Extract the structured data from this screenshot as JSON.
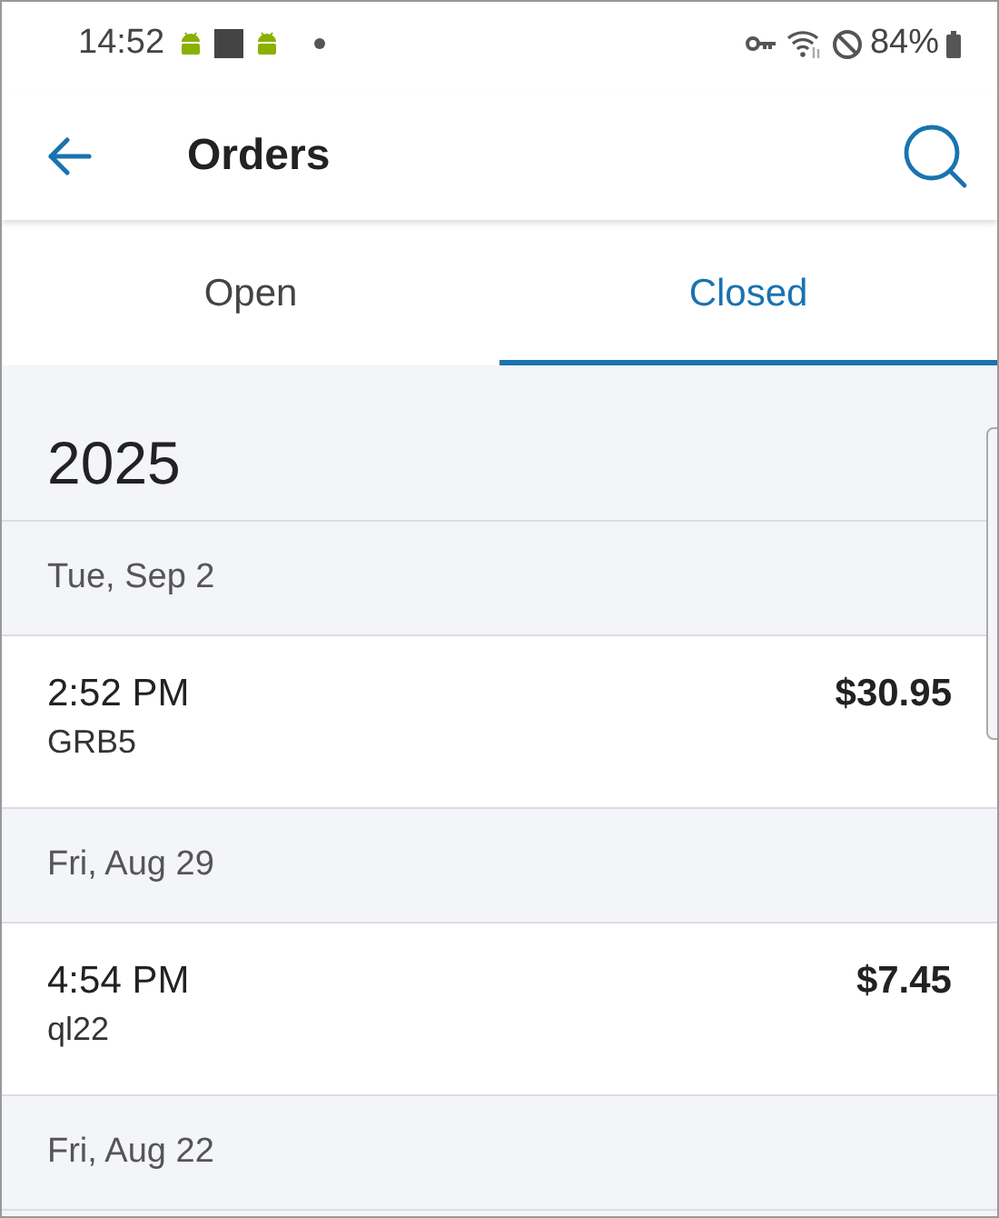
{
  "status_bar": {
    "time": "14:52",
    "battery": "84%"
  },
  "app_bar": {
    "title": "Orders"
  },
  "tabs": [
    {
      "label": "Open",
      "selected": false
    },
    {
      "label": "Closed",
      "selected": true
    }
  ],
  "year": "2025",
  "groups": [
    {
      "date": "Tue, Sep 2",
      "orders": [
        {
          "time": "2:52 PM",
          "code": "GRB5",
          "amount": "$30.95"
        }
      ]
    },
    {
      "date": "Fri, Aug 29",
      "orders": [
        {
          "time": "4:54 PM",
          "code": "ql22",
          "amount": "$7.45"
        }
      ]
    },
    {
      "date": "Fri, Aug 22"
    }
  ]
}
